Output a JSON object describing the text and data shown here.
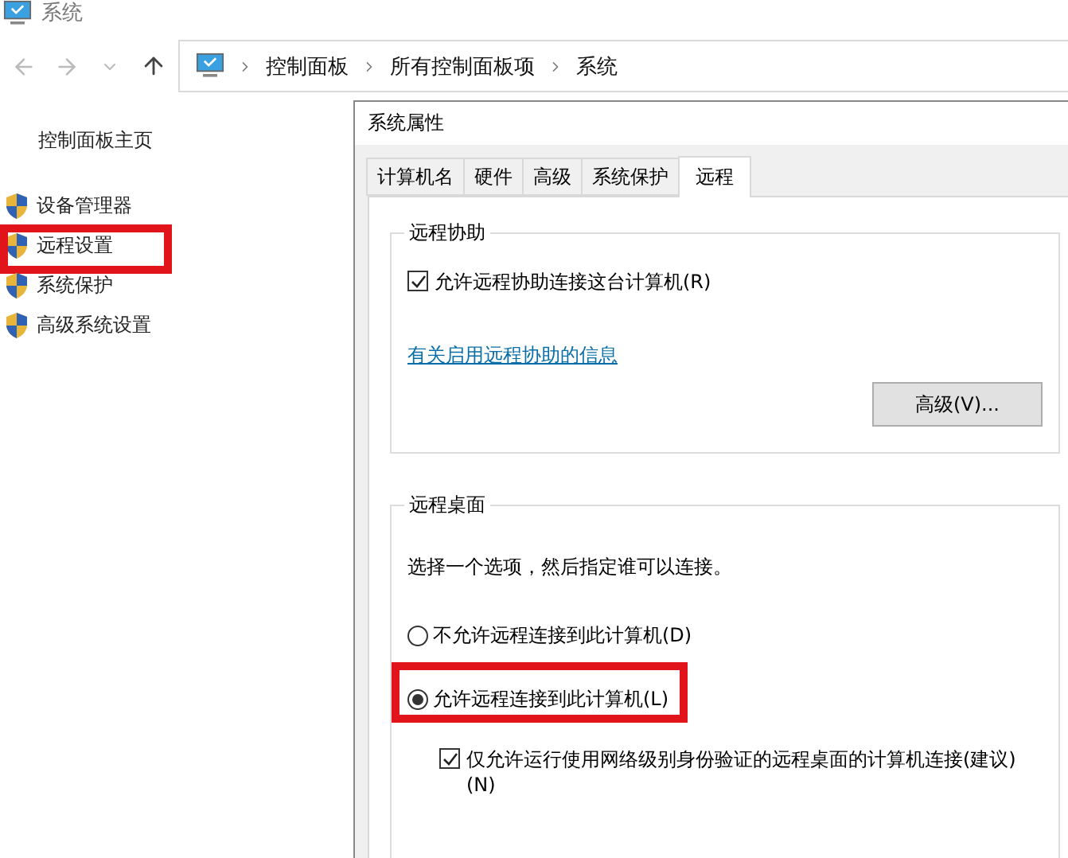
{
  "window": {
    "title": "系统"
  },
  "address_bar": {
    "path": [
      "控制面板",
      "所有控制面板项",
      "系统"
    ]
  },
  "sidebar": {
    "home_link": "控制面板主页",
    "items": [
      {
        "label": "设备管理器",
        "highlighted": false
      },
      {
        "label": "远程设置",
        "highlighted": true
      },
      {
        "label": "系统保护",
        "highlighted": false
      },
      {
        "label": "高级系统设置",
        "highlighted": false
      }
    ]
  },
  "dialog": {
    "title": "系统属性",
    "tabs": [
      {
        "label": "计算机名",
        "selected": false
      },
      {
        "label": "硬件",
        "selected": false
      },
      {
        "label": "高级",
        "selected": false
      },
      {
        "label": "系统保护",
        "selected": false
      },
      {
        "label": "远程",
        "selected": true
      }
    ],
    "remote_assistance": {
      "title": "远程协助",
      "allow": {
        "label": "允许远程协助连接这台计算机(R)",
        "checked": true
      },
      "info_link": "有关启用远程协助的信息",
      "advanced_button": "高级(V)..."
    },
    "remote_desktop": {
      "title": "远程桌面",
      "instruction": "选择一个选项，然后指定谁可以连接。",
      "options": [
        {
          "label": "不允许远程连接到此计算机(D)",
          "selected": false,
          "highlighted": false
        },
        {
          "label": "允许远程连接到此计算机(L)",
          "selected": true,
          "highlighted": true
        }
      ],
      "nla": {
        "label": "仅允许运行使用网络级别身份验证的远程桌面的计算机连接(建议)(N)",
        "checked": true
      }
    }
  }
}
